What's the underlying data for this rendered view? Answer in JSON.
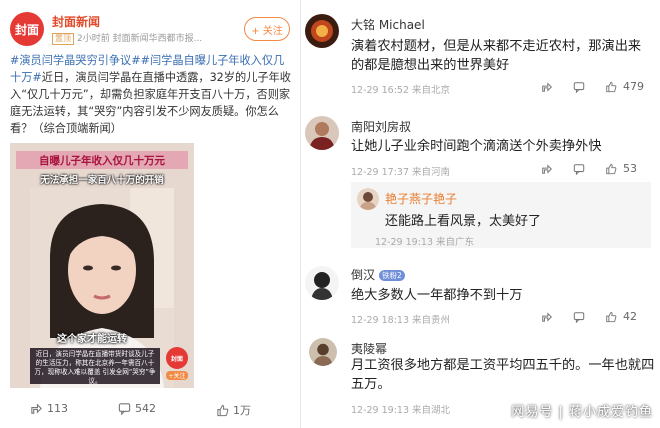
{
  "post": {
    "avatar_text": "封面",
    "author": "封面新闻",
    "top_badge": "置顶",
    "meta": "2小时前  封面新闻华西都市报...",
    "follow_label": "+ 关注",
    "hashtag1": "#演员闫学晶哭穷引争议#",
    "hashtag2": "#闫学晶自曝儿子年收入仅几十万#",
    "body": "近日，演员闫学晶在直播中透露，32岁的儿子年收入“仅几十万元”，却需负担家庭年开支百八十万，否则家庭无法运转，其“哭穷”内容引发不少网友质疑。你怎么看？（综合顶端新闻）",
    "video": {
      "caption1": "自曝儿子年收入仅几十万元",
      "caption2": "无法承担一家百八十万的开销",
      "caption3": "这个家才能运转",
      "subtitle": "近日，演员闫学晶在直播带货时谈及儿子的生活压力，称其在北京养一年需百八十万，现称收入难以覆盖 引发全网“哭穷”争议。",
      "logo": "封面",
      "follow": "+关注"
    },
    "actions": {
      "shares": "113",
      "comments": "542",
      "likes": "1万"
    }
  },
  "comments": [
    {
      "name": "大铭 Michael",
      "text": "演着农村题材，但是从来都不走近农村，那演出来的都是臆想出来的世界美好",
      "meta": "12-29 16:52  来自北京",
      "likes": "479"
    },
    {
      "name": "南阳刘房叔",
      "text": "让她儿子业余时间跑个滴滴送个外卖挣外快",
      "meta": "12-29 17:37  来自河南",
      "likes": "53",
      "reply": {
        "name": "艳子燕子艳子",
        "text": "还能路上看风景，太美好了",
        "meta": "12-29 19:13  来自广东"
      }
    },
    {
      "name": "倒汉",
      "badge": "铁粉2",
      "text": "绝大多数人一年都挣不到十万",
      "meta": "12-29 18:13  来自贵州",
      "likes": "42"
    },
    {
      "name": "夷陵幂",
      "text": "月工资很多地方都是工资平均四五千的。一年也就四五万。",
      "meta": "12-29 19:13  来自湖北"
    }
  ],
  "badge_small": "铁粉2",
  "watermark": "网易号 | 蒋小成爱钓鱼",
  "colors": {
    "accent_orange": "#f08a45",
    "link_blue": "#3a6fb0",
    "brand_red": "#e53935"
  }
}
